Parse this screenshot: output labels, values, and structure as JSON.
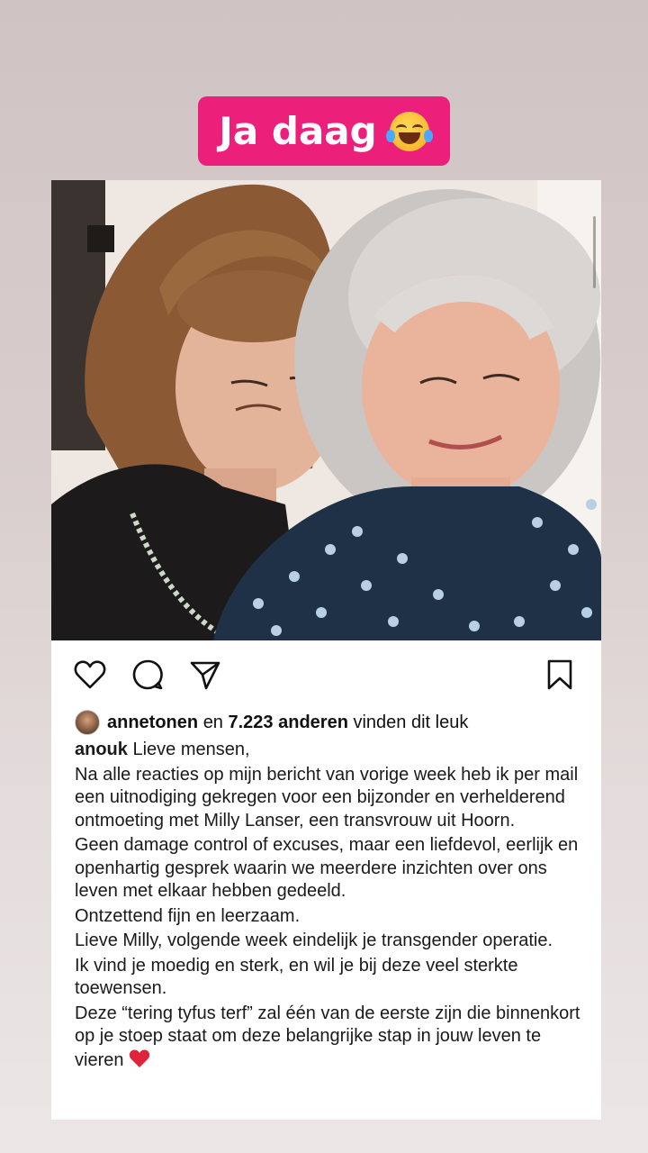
{
  "sticker": {
    "text": "Ja daag",
    "emoji": "face-with-tears-of-joy"
  },
  "post": {
    "photo_alt": "",
    "actions": [
      "heart-icon",
      "comment-icon",
      "share-icon",
      "bookmark-icon"
    ],
    "likes": {
      "user": "annetonen",
      "connector": "en",
      "count": "7.223 anderen",
      "suffix": "vinden dit leuk"
    },
    "caption": {
      "author": "anouk",
      "opening": "Lieve mensen,",
      "paragraphs": [
        "Na alle reacties op mijn bericht van vorige week heb ik per mail een uitnodiging gekregen voor een bijzonder en verhelderend ontmoeting met Milly Lanser, een transvrouw uit Hoorn.",
        "Geen damage control of excuses, maar een liefdevol, eerlijk en openhartig gesprek waarin we meerdere inzichten over ons leven met elkaar hebben gedeeld.",
        "Ontzettend fijn en leerzaam.",
        "Lieve Milly, volgende week eindelijk  je transgender operatie.",
        "Ik vind je moedig en sterk, en wil je bij deze veel sterkte toewensen.",
        "Deze “tering tyfus terf” zal één van de eerste zijn die binnenkort op je stoep staat om deze belangrijke stap in jouw leven te vieren"
      ],
      "closing_emoji": "❤️"
    }
  },
  "colors": {
    "sticker_bg": "#ec1f7a",
    "heart": "#e0243a"
  }
}
